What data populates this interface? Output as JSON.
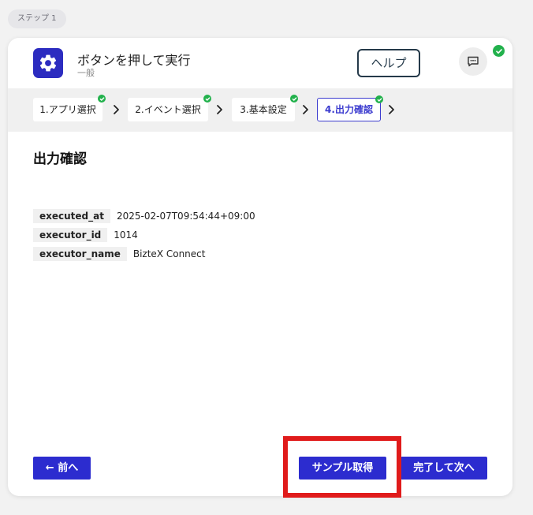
{
  "step_badge": "ステップ 1",
  "header": {
    "title": "ボタンを押して実行",
    "subtitle": "一般",
    "help_label": "ヘルプ"
  },
  "stepper": [
    {
      "label": "1.アプリ選択",
      "done": true
    },
    {
      "label": "2.イベント選択",
      "done": true
    },
    {
      "label": "3.基本設定",
      "done": true
    },
    {
      "label": "4.出力確認",
      "done": true,
      "active": true
    }
  ],
  "section_title": "出力確認",
  "outputs": [
    {
      "key": "executed_at",
      "value": "2025-02-07T09:54:44+09:00"
    },
    {
      "key": "executor_id",
      "value": "1014"
    },
    {
      "key": "executor_name",
      "value": "BizteX Connect"
    }
  ],
  "footer": {
    "back_label": "← 前へ",
    "sample_label": "サンプル取得",
    "next_label": "完了して次へ"
  },
  "colors": {
    "accent": "#2c2ccf",
    "success": "#22b14c",
    "highlight": "#e01b1b"
  }
}
